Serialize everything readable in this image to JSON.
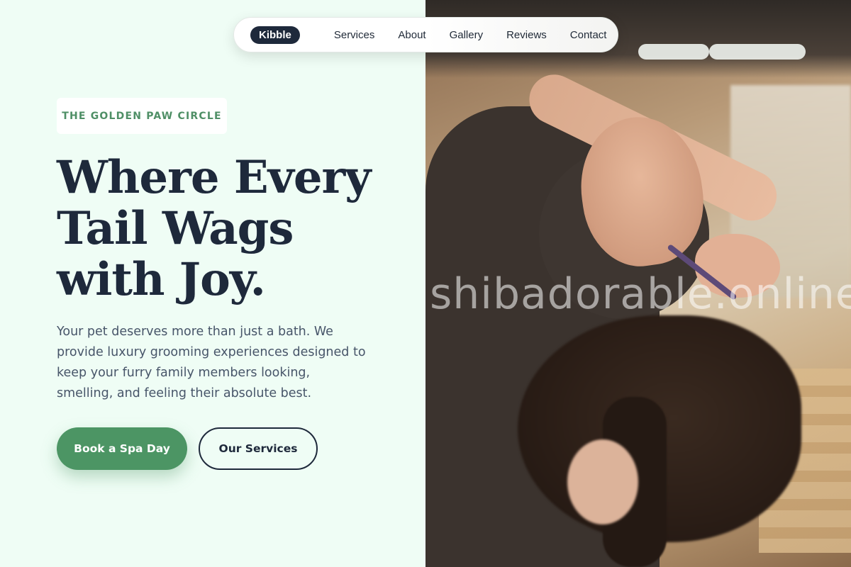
{
  "nav": {
    "brand": "Kibble",
    "links": [
      "Services",
      "About",
      "Gallery",
      "Reviews",
      "Contact"
    ]
  },
  "hero": {
    "badge": "THE GOLDEN PAW CIRCLE",
    "headline_lines": [
      "Where Every",
      "Tail Wags",
      "with Joy."
    ],
    "description": "Your pet deserves more than just a bath. We provide luxury grooming experiences designed to keep your furry family members looking, smelling, and feeling their absolute best.",
    "primary_button": "Book a Spa Day",
    "secondary_button": "Our Services"
  },
  "photo": {
    "watermark": "shibadorable.online"
  },
  "colors": {
    "accent_green": "#4c9564",
    "navy": "#1e293b",
    "background_mint": "#effdf5"
  }
}
